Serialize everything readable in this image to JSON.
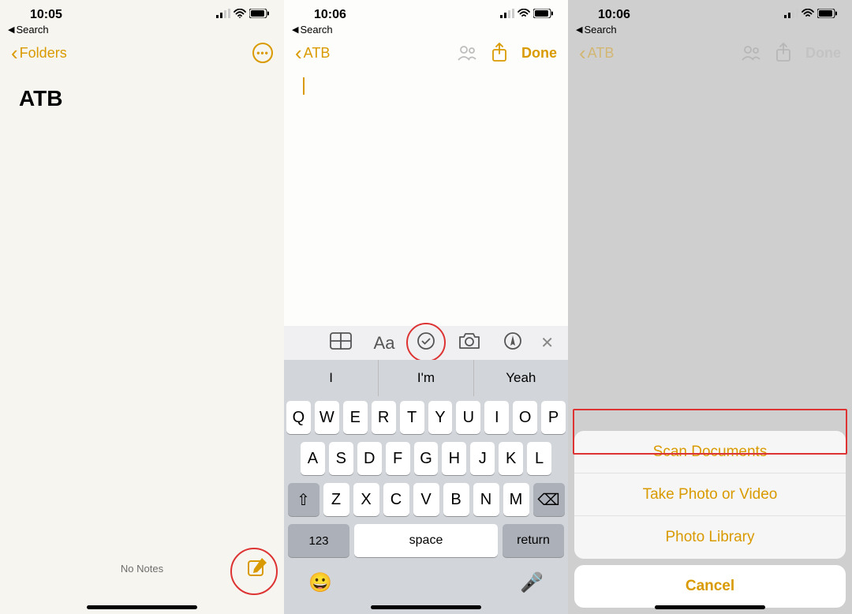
{
  "screen1": {
    "time": "10:05",
    "back_search": "Search",
    "back_label": "Folders",
    "note_title": "ATB",
    "no_notes": "No Notes"
  },
  "screen2": {
    "time": "10:06",
    "back_search": "Search",
    "back_label": "ATB",
    "done": "Done",
    "toolbar": {
      "aa": "Aa"
    },
    "suggestions": [
      "I",
      "I'm",
      "Yeah"
    ],
    "rows": {
      "r1": [
        "Q",
        "W",
        "E",
        "R",
        "T",
        "Y",
        "U",
        "I",
        "O",
        "P"
      ],
      "r2": [
        "A",
        "S",
        "D",
        "F",
        "G",
        "H",
        "J",
        "K",
        "L"
      ],
      "r3": [
        "Z",
        "X",
        "C",
        "V",
        "B",
        "N",
        "M"
      ]
    },
    "key123": "123",
    "space": "space",
    "return": "return"
  },
  "screen3": {
    "time": "10:06",
    "back_search": "Search",
    "back_label": "ATB",
    "done": "Done",
    "sheet": {
      "scan": "Scan Documents",
      "photo": "Take Photo or Video",
      "library": "Photo Library",
      "cancel": "Cancel"
    }
  },
  "colors": {
    "accent": "#d99a00",
    "highlight": "#d33"
  }
}
